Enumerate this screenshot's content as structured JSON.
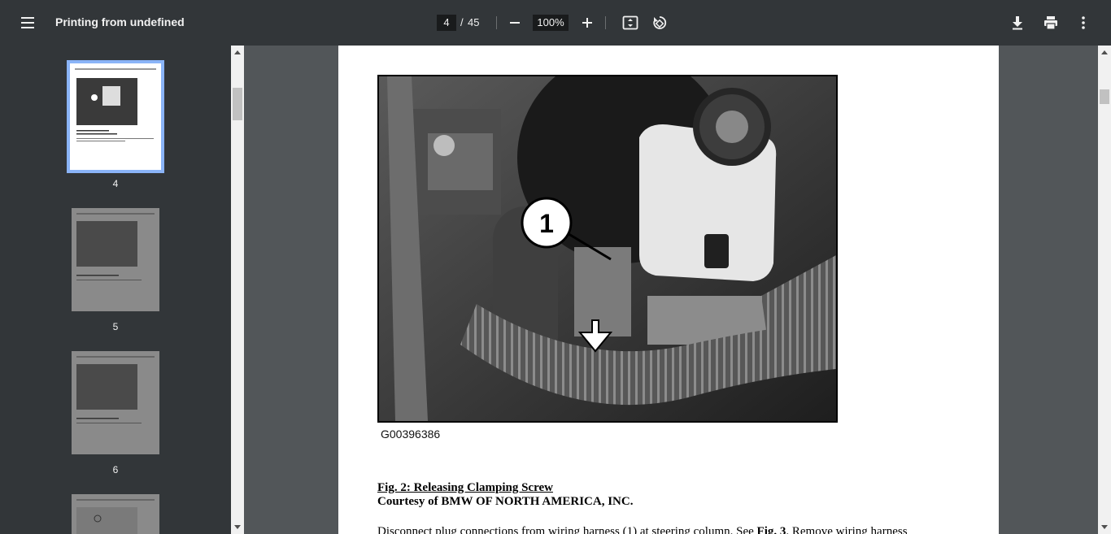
{
  "toolbar": {
    "title": "Printing from undefined",
    "current_page": "4",
    "page_separator": "/",
    "total_pages": "45",
    "zoom": "100%"
  },
  "sidebar": {
    "thumbnails": [
      {
        "page": "4"
      },
      {
        "page": "5"
      },
      {
        "page": "6"
      }
    ]
  },
  "document": {
    "figure_code": "G00396386",
    "caption": "Fig. 2: Releasing Clamping Screw",
    "courtesy": "Courtesy of BMW OF NORTH AMERICA, INC.",
    "body_start": "Disconnect plug connections from wiring harness (1) at steering column. See",
    "body_bold": "Fig. 3",
    "body_end": ". Remove wiring harness",
    "callout_number": "1"
  },
  "colors": {
    "toolbar_bg": "#323639",
    "viewer_bg": "#525659",
    "selection": "#8ab4f8"
  }
}
